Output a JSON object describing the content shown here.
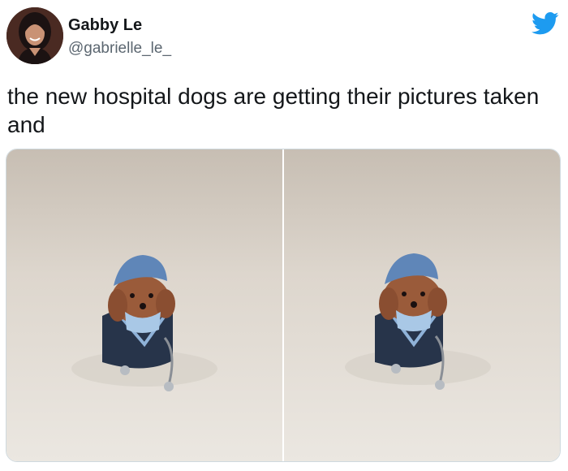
{
  "tweet": {
    "author": {
      "display_name": "Gabby Le",
      "handle": "@gabrielle_le_",
      "avatar_icon": "profile-photo"
    },
    "text": "the new hospital dogs are getting their pictures taken and",
    "media": [
      {
        "icon": "dog-in-scrubs-photo"
      },
      {
        "icon": "dog-in-scrubs-photo"
      }
    ],
    "brand_icon": "twitter-bird-icon"
  },
  "colors": {
    "twitter_blue": "#1d9bf0",
    "text": "#14171a",
    "secondary_text": "#5b6670",
    "scrub_blue": "#5f86b8",
    "backdrop": "#d9d2c8"
  }
}
